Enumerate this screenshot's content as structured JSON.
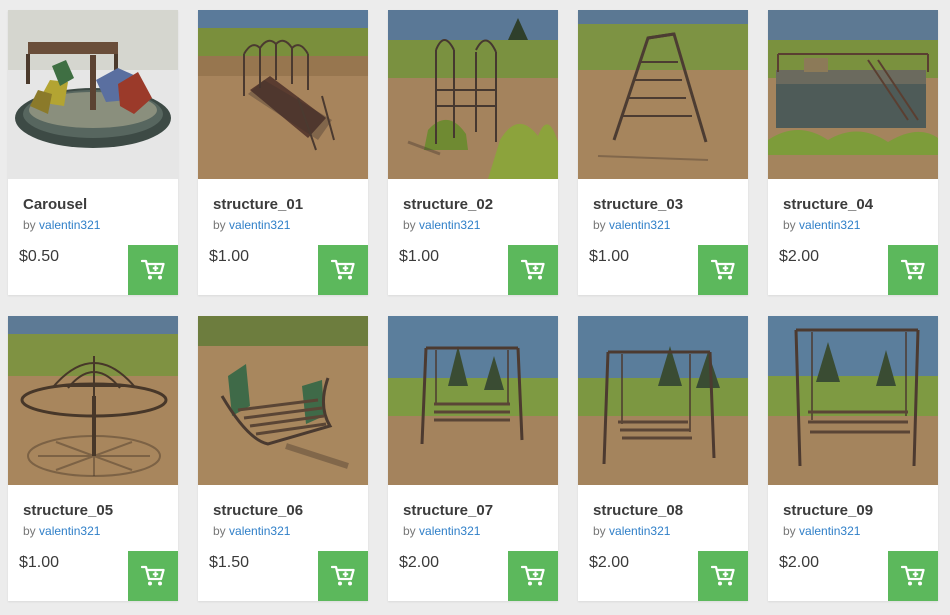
{
  "products": [
    {
      "title": "Carousel",
      "by": "by",
      "author": "valentin321",
      "price": "$0.50",
      "thumb_icon": "carousel-thumbnail"
    },
    {
      "title": "structure_01",
      "by": "by",
      "author": "valentin321",
      "price": "$1.00",
      "thumb_icon": "bench-arch-thumbnail"
    },
    {
      "title": "structure_02",
      "by": "by",
      "author": "valentin321",
      "price": "$1.00",
      "thumb_icon": "climbing-frame-thumbnail"
    },
    {
      "title": "structure_03",
      "by": "by",
      "author": "valentin321",
      "price": "$1.00",
      "thumb_icon": "a-frame-ladder-thumbnail"
    },
    {
      "title": "structure_04",
      "by": "by",
      "author": "valentin321",
      "price": "$2.00",
      "thumb_icon": "platform-thumbnail"
    },
    {
      "title": "structure_05",
      "by": "by",
      "author": "valentin321",
      "price": "$1.00",
      "thumb_icon": "dome-roundabout-thumbnail"
    },
    {
      "title": "structure_06",
      "by": "by",
      "author": "valentin321",
      "price": "$1.50",
      "thumb_icon": "rocking-bench-thumbnail"
    },
    {
      "title": "structure_07",
      "by": "by",
      "author": "valentin321",
      "price": "$2.00",
      "thumb_icon": "swing-thumbnail"
    },
    {
      "title": "structure_08",
      "by": "by",
      "author": "valentin321",
      "price": "$2.00",
      "thumb_icon": "swing-thumbnail"
    },
    {
      "title": "structure_09",
      "by": "by",
      "author": "valentin321",
      "price": "$2.00",
      "thumb_icon": "swing-thumbnail"
    }
  ],
  "colors": {
    "cart_button": "#5cb85c",
    "author_link": "#2f7fc8",
    "page_background": "#ececec"
  },
  "cart_icon": "add-to-cart-icon"
}
